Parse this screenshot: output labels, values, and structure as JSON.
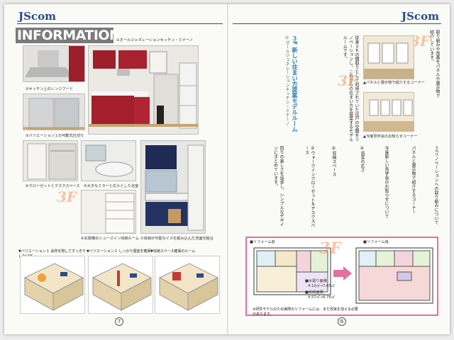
{
  "header": {
    "brand": "JScom",
    "section": "INFORMATION"
  },
  "captions": {
    "c1": "①オールジェネレーションキッチン・ミナーノ",
    "c2": "②キッチン上のレンジフード",
    "c3": "③バリエーション１の可動式仕切り",
    "c4": "④クローゼットとデスクスペース",
    "c5": "⑤大きなミラーと広々とした浴室",
    "c6": "⑥玄関横のシューズイン収納ルーム",
    "c7": "⑦収納が可能なイスを組み込んだ洗面化粧台"
  },
  "variations": {
    "v1": "▼バリエーション１ 会所を隠してすっきりしたLDK",
    "v2": "▼バリエーション２ しっかり個室を確保",
    "v3": "▼収納スペース確保のルーム"
  },
  "pages": {
    "left": "7",
    "right": "6"
  },
  "right": {
    "col1": "取り組みや改善をパネルや展示物で紹介しています。",
    "col2": "３Fリノベーションへの取り組みについて",
    "col3": "パネルと展示物で紹介するコーナー",
    "col4": "今度新しい見学会のお知らせについて",
    "title": "３F 新しい住まい方提案モデルルーム",
    "subtitle": "①オールジェネレーションキッチン・ミナーノ",
    "body1": "従来２Ｋの間取りとして利用されていた住戸の空間をリノベーションし、これからの住まい方を提案するモデルルームです。",
    "body2": "回りの美しさを追求し、シンプルなデザインにまとめています。",
    "body3": "③ウォークインクローゼット＆デスクスペース",
    "body4": "④浴室の広さ",
    "body5": "⑥収納スペース",
    "photo_cap1": "▲パネルと展示物で紹介するコーナー",
    "photo_cap2": "▲今度見学会のお知らせコーナー",
    "plan_before": "■リフォーム前",
    "plan_after": "■リフォーム後",
    "area1": "■水廻り面積",
    "area1v": "4.13㎡→7.65㎡",
    "area2": "■収納面積",
    "area2v": "4.57㎡→8.76㎡",
    "note": "※研究モデルのため実際のリフォームには、まだ改良を加える必要があります。"
  },
  "colors": {
    "brand": "#2a4c8a",
    "accent": "#e46fa0",
    "green": "#3a8a3a"
  }
}
